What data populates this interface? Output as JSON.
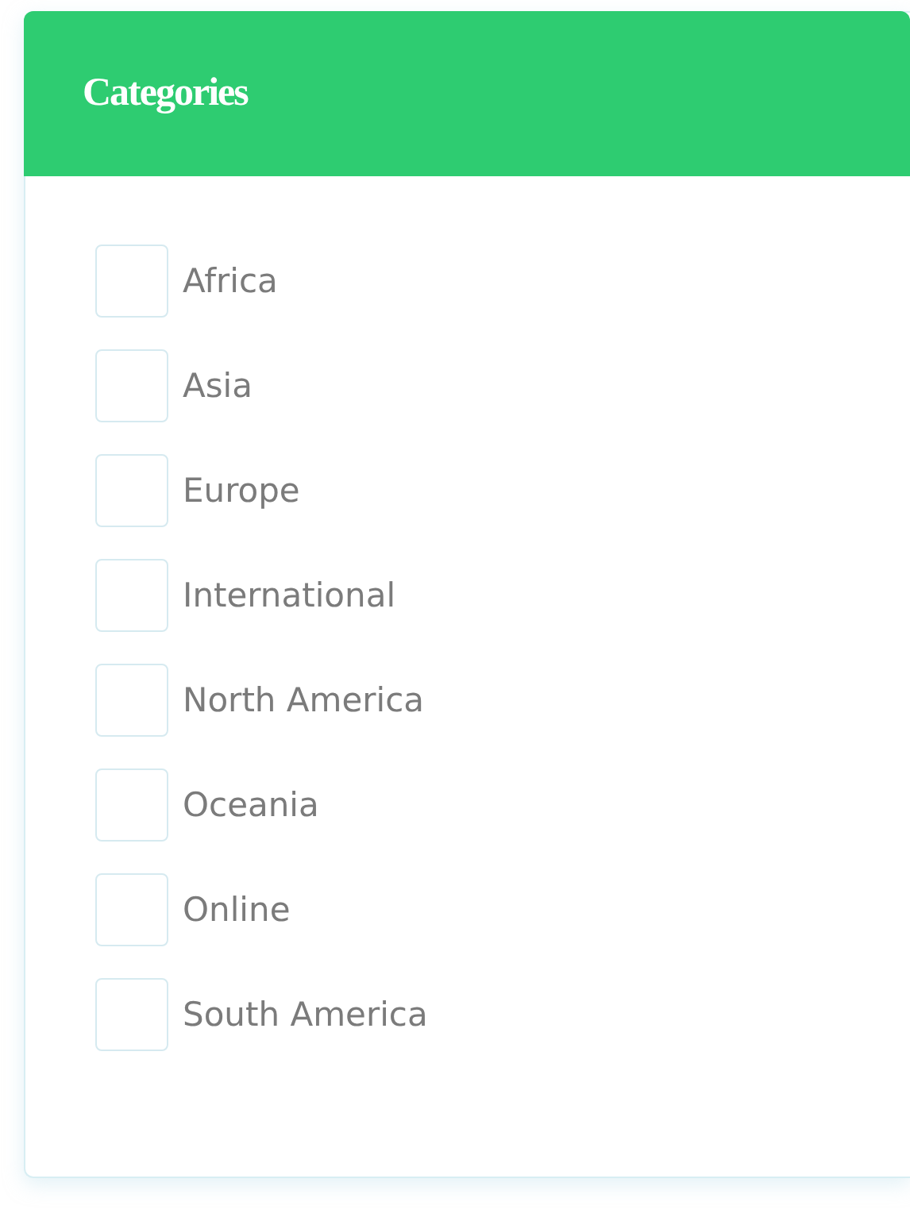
{
  "panel": {
    "title": "Categories",
    "items": [
      {
        "label": "Africa",
        "checked": false
      },
      {
        "label": "Asia",
        "checked": false
      },
      {
        "label": "Europe",
        "checked": false
      },
      {
        "label": "International",
        "checked": false
      },
      {
        "label": "North America",
        "checked": false
      },
      {
        "label": "Oceania",
        "checked": false
      },
      {
        "label": "Online",
        "checked": false
      },
      {
        "label": "South America",
        "checked": false
      }
    ]
  }
}
